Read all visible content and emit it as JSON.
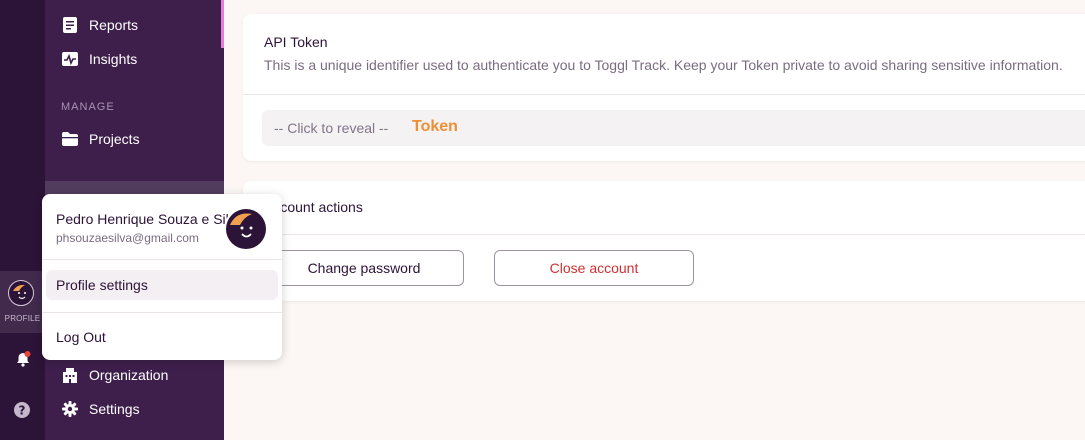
{
  "sidebar": {
    "items": [
      {
        "label": "Reports",
        "icon": "reports-icon"
      },
      {
        "label": "Insights",
        "icon": "insights-icon"
      },
      {
        "label": "Projects",
        "icon": "projects-icon"
      },
      {
        "label": "Organization",
        "icon": "organization-icon"
      },
      {
        "label": "Settings",
        "icon": "settings-icon"
      }
    ],
    "section_manage": "MANAGE"
  },
  "rail": {
    "profile_label": "PROFILE"
  },
  "api_token": {
    "title": "API Token",
    "description": "This is a unique identifier used to authenticate you to Toggl Track. Keep your Token private to avoid sharing sensitive information.",
    "reveal_text": "-- Click to reveal --",
    "token_label": "Token"
  },
  "account_actions": {
    "title": "Account actions",
    "change_password": "Change password",
    "close_account": "Close account"
  },
  "profile_menu": {
    "name": "Pedro Henrique Souza e Silva",
    "email": "phsouzaesilva@gmail.com",
    "profile_settings": "Profile settings",
    "log_out": "Log Out"
  },
  "colors": {
    "rail_bg": "#2c1338",
    "sidebar_bg": "#3e1f4c",
    "accent_orange": "#f08e35",
    "danger": "#d03030",
    "page_bg": "#fcf7f5"
  }
}
